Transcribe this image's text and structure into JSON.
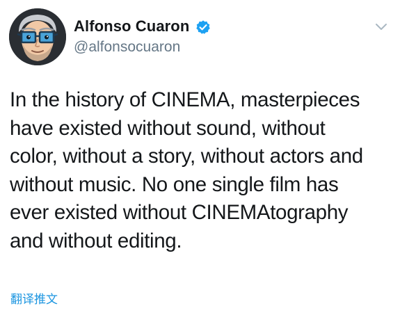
{
  "author": {
    "name": "Alfonso Cuaron",
    "handle": "@alfonsocuaron",
    "verified": true,
    "avatar": "cartoon-portrait-with-blue-glasses"
  },
  "tweet": {
    "lines": [
      "In the history of CINEMA, masterpieces",
      "have existed without sound, without",
      "color, without a story, without actors and",
      "without music. No one single film has",
      "ever existed without CINEMAtography",
      "and without editing."
    ]
  },
  "actions": {
    "translate_label": "翻译推文"
  },
  "icons": {
    "verified": "verified-badge-icon",
    "menu": "chevron-down-icon"
  },
  "colors": {
    "name": "#14171a",
    "handle": "#657786",
    "link": "#1b95e0",
    "verified": "#1da1f2",
    "chevron": "#aab8c2"
  }
}
